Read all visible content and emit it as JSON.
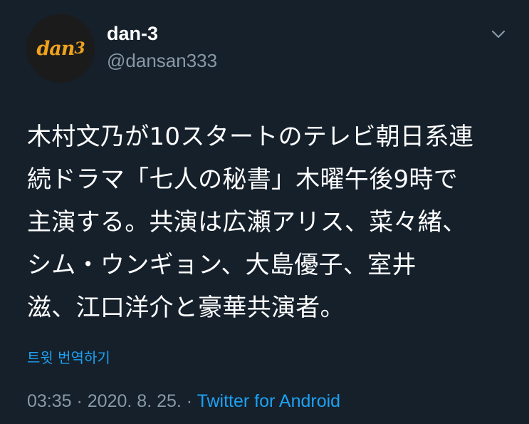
{
  "author": {
    "display_name": "dan-3",
    "handle": "@dansan333",
    "avatar_logo_text": "dan3"
  },
  "header": {
    "menu_icon": "chevron-down-icon"
  },
  "tweet": {
    "text": "木村文乃が10スタートのテレビ朝日系連\n続ドラマ「七人の秘書」木曜午後9時で\n主演する。共演は広瀬アリス、菜々緒、\nシム・ウンギョン、大島優子、室井\n滋、江口洋介と豪華共演者。",
    "translate_label": "트윗 번역하기"
  },
  "meta": {
    "time": "03:35",
    "separator": " · ",
    "date": "2020. 8. 25.",
    "separator2": " · ",
    "source": "Twitter for Android"
  },
  "colors": {
    "background": "#15202b",
    "text_primary": "#ffffff",
    "text_secondary": "#8899a6",
    "accent": "#1da1f2",
    "avatar_logo": "#f0a21c"
  }
}
